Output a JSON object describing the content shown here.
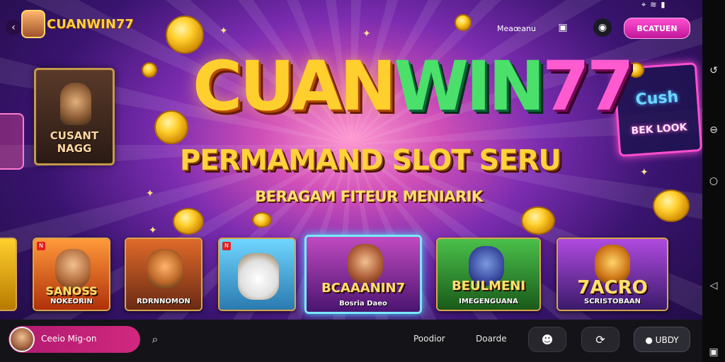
{
  "app": {
    "logo_text": "CUANWIN77",
    "colors": {
      "accent": "#d0287e",
      "gold": "#ffcf2e",
      "cta": "#ff4fd0"
    }
  },
  "status_bar": {
    "icons": [
      "location-icon",
      "wifi-icon",
      "battery-icon"
    ]
  },
  "header": {
    "back_icon": "chevron-left-icon",
    "link_label": "Meaœanu",
    "icon_button_1": "gift-icon",
    "icon_button_2": "settings-icon",
    "cta_label": "BCATUEN"
  },
  "hero": {
    "title_part1": "CUAN",
    "title_part2": "WIN",
    "title_part3": "77",
    "subtitle": "PERMAMAND SLOT SERU",
    "tagline": "BERAGAM FITEUR MENIARIK"
  },
  "decor": {
    "left_card_label_1": "CUSANT",
    "left_card_label_2": "NAGG",
    "neon_line_1": "Cush",
    "neon_line_2": "BEK LOOK"
  },
  "games": [
    {
      "title": "SANOSS",
      "caption": "NOKEORIN",
      "badge": "N"
    },
    {
      "title": "",
      "caption": "RDRNNOMON",
      "badge": ""
    },
    {
      "title": "",
      "caption": "",
      "badge": "N"
    },
    {
      "title": "BCAAANIN7",
      "caption": "Bosria Daeo",
      "badge": ""
    },
    {
      "title": "BEULMENI",
      "caption": "IMEGENGUANA",
      "badge": ""
    },
    {
      "title": "7ACRO",
      "caption": "SCRISTOBAAN",
      "badge": ""
    }
  ],
  "bottom_bar": {
    "user_name": "Ceeio Mig-on",
    "search_icon": "search-icon",
    "link_1": "Poodior",
    "link_2": "Doarde",
    "icon_button_1": "user-icon",
    "icon_button_2": "refresh-icon",
    "wide_button_label": "UBDY"
  },
  "android_nav": [
    "back-icon",
    "home-icon",
    "recents-icon",
    "square-icon"
  ]
}
